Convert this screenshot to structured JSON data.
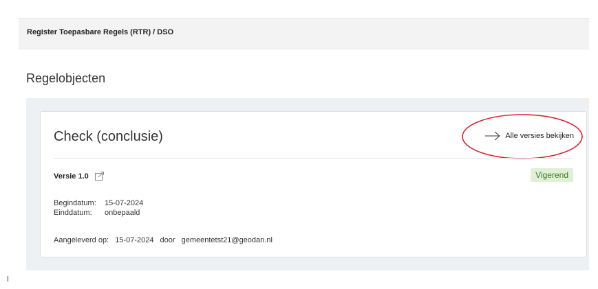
{
  "header": {
    "breadcrumb": "Register Toepasbare Regels (RTR) / DSO"
  },
  "page": {
    "title": "Regelobjecten"
  },
  "card": {
    "title": "Check (conclusie)",
    "versions_link_label": "Alle versies bekijken",
    "version_label": "Versie 1.0",
    "status": "Vigerend",
    "start_date_label": "Begindatum:",
    "start_date_value": "15-07-2024",
    "end_date_label": "Einddatum:",
    "end_date_value": "onbepaald",
    "delivered_label": "Aangeleverd op:",
    "delivered_date": "15-07-2024",
    "delivered_by_label": "door",
    "delivered_by_value": "gemeentetst21@geodan.nl"
  },
  "colors": {
    "status_bg": "#e0efd6",
    "status_text": "#3b7a2b",
    "highlight": "#d9232e",
    "panel_bg": "#eef1f4"
  },
  "icons": {
    "versions_link": "arrow-right-icon",
    "version_external": "external-link-icon"
  }
}
